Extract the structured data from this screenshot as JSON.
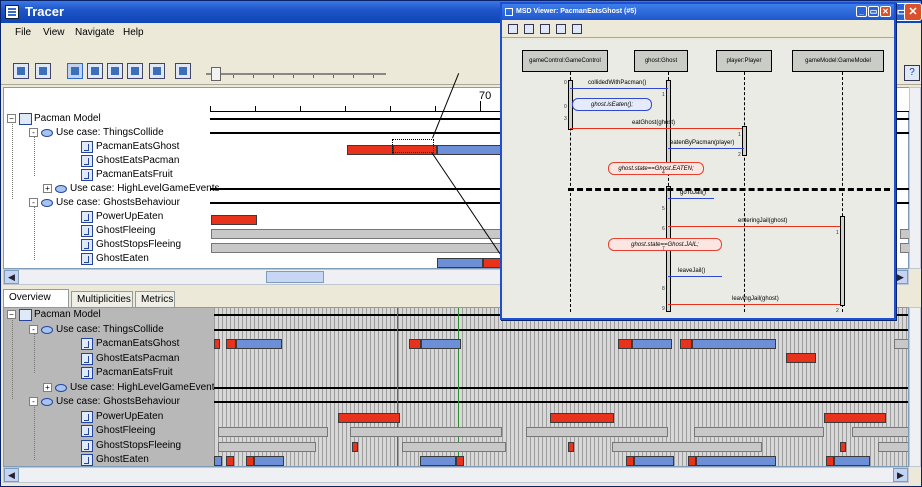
{
  "app": {
    "title": "Tracer"
  },
  "menu": [
    "File",
    "View",
    "Navigate",
    "Help"
  ],
  "ruler": {
    "label": "70"
  },
  "tree": {
    "root": "Pacman Model",
    "items": [
      {
        "label": "Use case: ThingsCollide",
        "kind": "usecase",
        "expanded": "-"
      },
      {
        "label": "PacmanEatsGhost",
        "kind": "msd"
      },
      {
        "label": "GhostEatsPacman",
        "kind": "msd"
      },
      {
        "label": "PacmanEatsFruit",
        "kind": "msd"
      },
      {
        "label": "Use case: HighLevelGameEvents",
        "kind": "usecase",
        "expanded": "+"
      },
      {
        "label": "Use case: GhostsBehaviour",
        "kind": "usecase",
        "expanded": "-"
      },
      {
        "label": "PowerUpEaten",
        "kind": "msd"
      },
      {
        "label": "GhostFleeing",
        "kind": "msd"
      },
      {
        "label": "GhostStopsFleeing",
        "kind": "msd"
      },
      {
        "label": "GhostEaten",
        "kind": "msd"
      }
    ]
  },
  "tabs": [
    "Overview",
    "Multiplicities",
    "Metrics"
  ],
  "msd": {
    "title": "MSD Viewer: PacmanEatsGhost (#5)",
    "lifelines": [
      "gameControl:GameControl",
      "ghost:Ghost",
      "player:Player",
      "gameModel:GameModel"
    ],
    "messages": [
      {
        "label": "collidedWithPacman()",
        "seq": "0"
      },
      {
        "label": "ghost.isEaten();",
        "seq": "1"
      },
      {
        "label": "eatGhost(ghost)",
        "seq": "1"
      },
      {
        "label": "eatenByPacman(player)",
        "seq": "2"
      },
      {
        "label": "ghost.state==Ghost.EATEN;",
        "seq": "4"
      },
      {
        "label": "goToJail()",
        "seq": "5"
      },
      {
        "label": "enteringJail(ghost)",
        "seq": "6"
      },
      {
        "label": "ghost.state==Ghost.JAIL;",
        "seq": "7"
      },
      {
        "label": "leaveJail()",
        "seq": "8"
      },
      {
        "label": "leavingJail(ghost)",
        "seq": "9"
      }
    ],
    "seq_extra": [
      "0",
      "1",
      "2",
      "3",
      "1",
      "2",
      "3",
      "1",
      "2"
    ]
  },
  "scroll": {
    "thumb_label": "|||"
  },
  "colors": {
    "accent": "#1e55c8",
    "red": "#e8321c",
    "blue": "#6c8fd8",
    "green": "#2d8a2d"
  }
}
